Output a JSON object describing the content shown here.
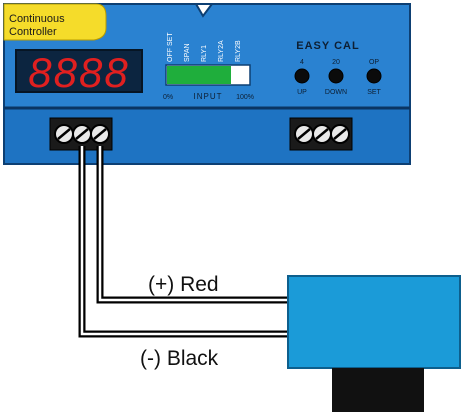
{
  "controller": {
    "title_line1": "Continuous",
    "title_line2": "Controller",
    "display_digits": "8888",
    "input_bar": {
      "column_labels": [
        "OFF SET",
        "SPAN",
        "RLY1",
        "RLY2A",
        "RLY2B"
      ],
      "min_label": "0%",
      "center_label": "INPUT",
      "max_label": "100%",
      "fill_fraction": 0.78
    },
    "easy_cal": {
      "title": "EASY CAL",
      "buttons": [
        {
          "top": "4",
          "bottom": "UP"
        },
        {
          "top": "20",
          "bottom": "DOWN"
        },
        {
          "top": "OP",
          "bottom": "SET"
        }
      ]
    }
  },
  "wires": {
    "positive_label": "(+) Red",
    "negative_label": "(-) Black"
  },
  "colors": {
    "panel_blue": "#2a82d1",
    "lower_blue": "#1e73c2",
    "display_red": "#e02020",
    "bar_green": "#1fae3c",
    "title_yellow": "#f5dc2a",
    "sensor_blue": "#1b9bd8"
  }
}
